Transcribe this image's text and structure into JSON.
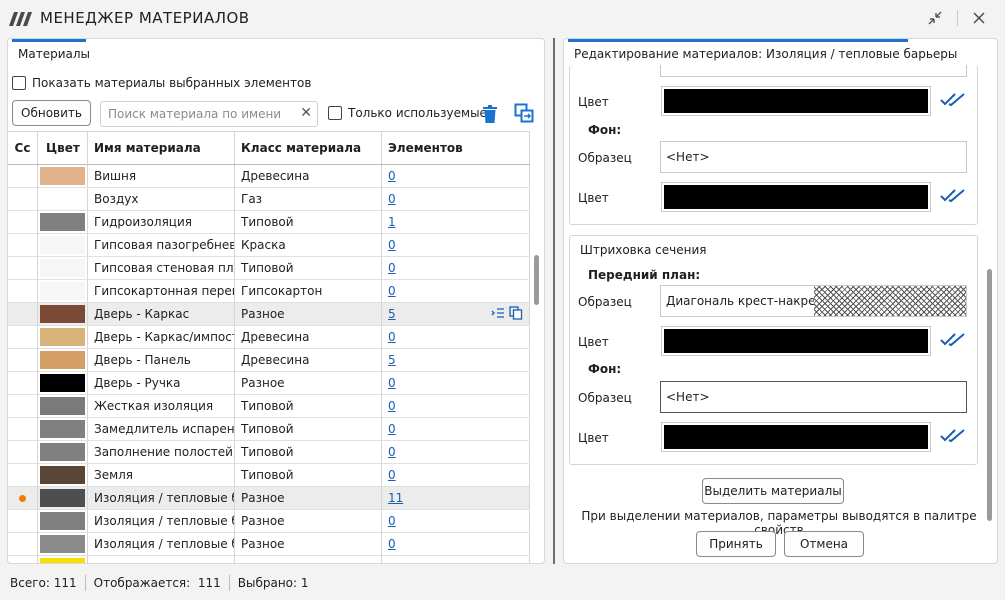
{
  "window": {
    "title": "МЕНЕДЖЕР МАТЕРИАЛОВ",
    "buttons": {
      "collapse": "collapse-icon",
      "close": "close-icon"
    }
  },
  "left": {
    "tab_label": "Материалы",
    "show_selected_label": "Показать материалы выбранных элементов",
    "refresh_label": "Обновить",
    "search_placeholder": "Поиск материала по имени",
    "only_used_label": "Только используемые",
    "columns": [
      "Сс",
      "Цвет",
      "Имя материала",
      "Класс материала",
      "Элементов"
    ],
    "rows": [
      {
        "color": "#e2b38a",
        "name": "Вишня",
        "class": "Древесина",
        "count": "0",
        "marker": false,
        "selected": false
      },
      {
        "color": "",
        "name": "Воздух",
        "class": "Газ",
        "count": "0",
        "marker": false,
        "selected": false
      },
      {
        "color": "#808080",
        "name": "Гидроизоляция",
        "class": "Типовой",
        "count": "1",
        "marker": false,
        "selected": false
      },
      {
        "color": "#f6f6f6",
        "name": "Гипсовая пазогребневая",
        "class": "Краска",
        "count": "0",
        "marker": false,
        "selected": false
      },
      {
        "color": "#f6f6f6",
        "name": "Гипсовая стеновая плита",
        "class": "Типовой",
        "count": "0",
        "marker": false,
        "selected": false
      },
      {
        "color": "#f6f6f6",
        "name": "Гипсокартонная перегор",
        "class": "Гипсокартон",
        "count": "0",
        "marker": false,
        "selected": false
      },
      {
        "color": "#7a4a36",
        "name": "Дверь - Каркас",
        "class": "Разное",
        "count": "5",
        "marker": false,
        "selected": true,
        "actions": true
      },
      {
        "color": "#d9b47a",
        "name": "Дверь - Каркас/импост",
        "class": "Древесина",
        "count": "0",
        "marker": false,
        "selected": false
      },
      {
        "color": "#d4a066",
        "name": "Дверь - Панель",
        "class": "Древесина",
        "count": "5",
        "marker": false,
        "selected": false
      },
      {
        "color": "#000000",
        "name": "Дверь - Ручка",
        "class": "Разное",
        "count": "0",
        "marker": false,
        "selected": false
      },
      {
        "color": "#7a7a7a",
        "name": "Жесткая изоляция",
        "class": "Типовой",
        "count": "0",
        "marker": false,
        "selected": false
      },
      {
        "color": "#808080",
        "name": "Замедлитель испарения",
        "class": "Типовой",
        "count": "0",
        "marker": false,
        "selected": false
      },
      {
        "color": "#808080",
        "name": "Заполнение полостей",
        "class": "Типовой",
        "count": "0",
        "marker": false,
        "selected": false
      },
      {
        "color": "#5a4637",
        "name": "Земля",
        "class": "Типовой",
        "count": "0",
        "marker": false,
        "selected": false
      },
      {
        "color": "#4e4e4e",
        "name": "Изоляция / тепловые бар",
        "class": "Разное",
        "count": "11",
        "marker": true,
        "selected": true
      },
      {
        "color": "#808080",
        "name": "Изоляция / тепловые бар",
        "class": "Разное",
        "count": "0",
        "marker": false,
        "selected": false
      },
      {
        "color": "#8a8a8a",
        "name": "Изоляция / тепловые бар",
        "class": "Разное",
        "count": "0",
        "marker": false,
        "selected": false
      },
      {
        "color": "#f7e000",
        "name": "",
        "class": "",
        "count": "",
        "marker": false,
        "selected": false
      }
    ]
  },
  "right": {
    "header": "Редактирование материалов: Изоляция / тепловые барьеры",
    "top_group": {
      "color_label": "Цвет",
      "background_label": "Фон:",
      "sample_label": "Образец",
      "sample_value": "<Нет>",
      "color2_label": "Цвет"
    },
    "section_group": {
      "title": "Штриховка сечения",
      "foreground_label": "Передний план:",
      "sample_label": "Образец",
      "sample_value": "Диагональ крест-накрест,",
      "color_label": "Цвет",
      "background_label": "Фон:",
      "sample2_label": "Образец",
      "sample2_value": "<Нет>",
      "color2_label": "Цвет"
    },
    "select_button": "Выделить материалы",
    "info_text": "При выделении материалов, параметры выводятся в палитре свойств",
    "accept_button": "Принять",
    "cancel_button": "Отмена"
  },
  "status": {
    "total_label": "Всего:",
    "total": "111",
    "shown_label": "Отображается:",
    "shown": "111",
    "selected_label": "Выбрано:",
    "selected": "1"
  }
}
